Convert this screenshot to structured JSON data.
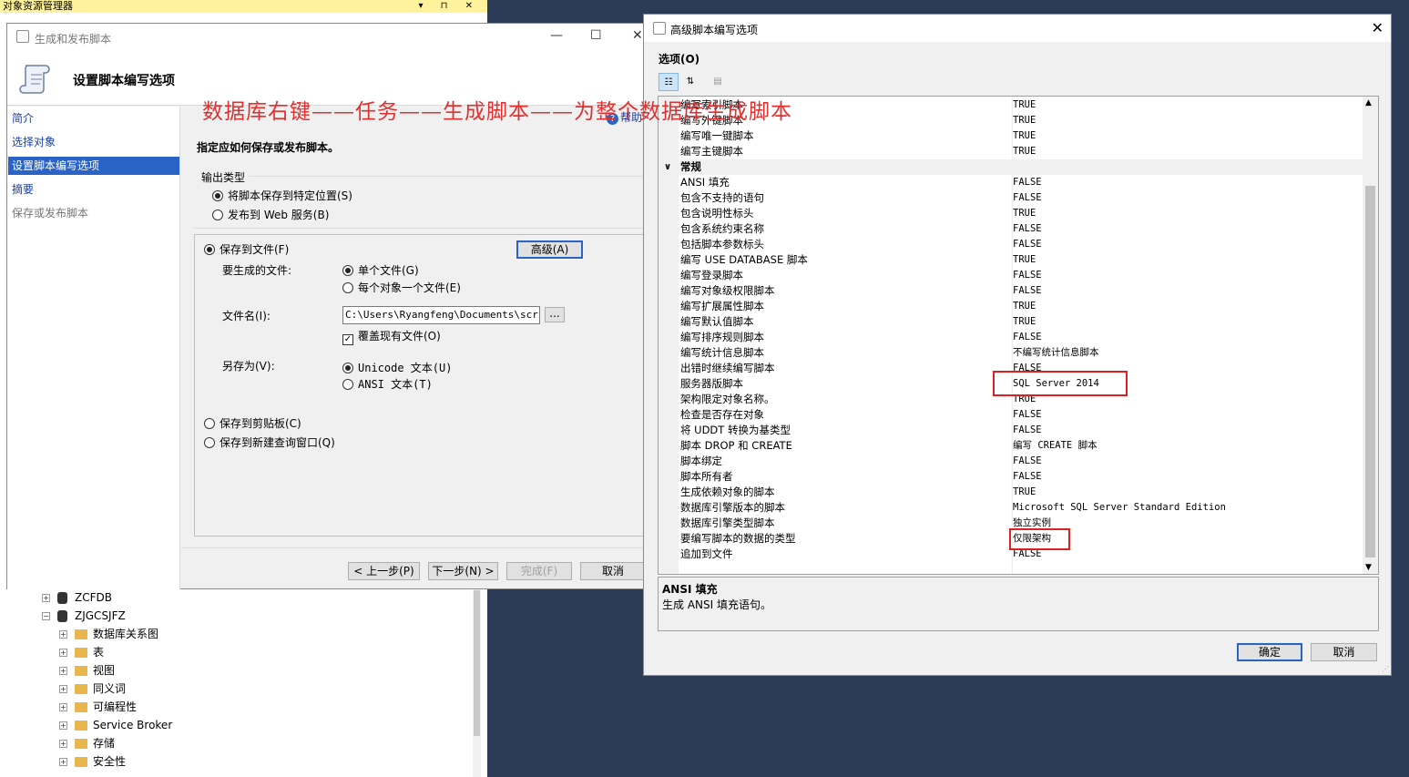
{
  "object_explorer": {
    "title": "对象资源管理器",
    "pin": "▾ ⊓ ✕",
    "tree": [
      {
        "expand": "+",
        "kind": "db",
        "label": "ZCFDB"
      },
      {
        "expand": "−",
        "kind": "db",
        "label": "ZJGCSJFZ"
      },
      {
        "expand": "+",
        "kind": "folder",
        "label": "数据库关系图"
      },
      {
        "expand": "+",
        "kind": "folder",
        "label": "表"
      },
      {
        "expand": "+",
        "kind": "folder",
        "label": "视图"
      },
      {
        "expand": "+",
        "kind": "folder",
        "label": "同义词"
      },
      {
        "expand": "+",
        "kind": "folder",
        "label": "可编程性"
      },
      {
        "expand": "+",
        "kind": "folder",
        "label": "Service Broker"
      },
      {
        "expand": "+",
        "kind": "folder",
        "label": "存储"
      },
      {
        "expand": "+",
        "kind": "folder",
        "label": "安全性"
      }
    ]
  },
  "wizard": {
    "window_title": "生成和发布脚本",
    "header_title": "设置脚本编写选项",
    "nav": [
      "简介",
      "选择对象",
      "设置脚本编写选项",
      "摘要",
      "保存或发布脚本"
    ],
    "help": "帮助",
    "instruction": "指定应如何保存或发布脚本。",
    "output_type_label": "输出类型",
    "output_save": "将脚本保存到特定位置(S)",
    "output_web": "发布到 Web 服务(B)",
    "save_to_file": "保存到文件(F)",
    "advanced_button": "高级(A)",
    "files_label": "要生成的文件:",
    "single_file": "单个文件(G)",
    "file_per_object": "每个对象一个文件(E)",
    "filename_label": "文件名(I):",
    "filename_value": "C:\\Users\\Ryangfeng\\Documents\\script",
    "browse": "...",
    "overwrite": "覆盖现有文件(O)",
    "save_as_label": "另存为(V):",
    "unicode": "Unicode 文本(U)",
    "ansi": "ANSI 文本(T)",
    "clipboard": "保存到剪贴板(C)",
    "new_query": "保存到新建查询窗口(Q)",
    "prev": "< 上一步(P)",
    "next": "下一步(N) >",
    "finish": "完成(F)",
    "cancel": "取消"
  },
  "annotation": "数据库右键——任务——生成脚本——为整个数据库生成脚本",
  "advanced": {
    "window_title": "高级脚本编写选项",
    "options_label": "选项(O)",
    "rows": [
      {
        "name": "编写索引脚本",
        "value": "TRUE"
      },
      {
        "name": "编写外键脚本",
        "value": "TRUE"
      },
      {
        "name": "编写唯一键脚本",
        "value": "TRUE"
      },
      {
        "name": "编写主键脚本",
        "value": "TRUE"
      },
      {
        "name": "常规",
        "category": true
      },
      {
        "name": "ANSI 填充",
        "value": "FALSE"
      },
      {
        "name": "包含不支持的语句",
        "value": "FALSE"
      },
      {
        "name": "包含说明性标头",
        "value": "TRUE"
      },
      {
        "name": "包含系统约束名称",
        "value": "FALSE"
      },
      {
        "name": "包括脚本参数标头",
        "value": "FALSE"
      },
      {
        "name": "编写 USE DATABASE 脚本",
        "value": "TRUE"
      },
      {
        "name": "编写登录脚本",
        "value": "FALSE"
      },
      {
        "name": "编写对象级权限脚本",
        "value": "FALSE"
      },
      {
        "name": "编写扩展属性脚本",
        "value": "TRUE"
      },
      {
        "name": "编写默认值脚本",
        "value": "TRUE"
      },
      {
        "name": "编写排序规则脚本",
        "value": "FALSE"
      },
      {
        "name": "编写统计信息脚本",
        "value": "不编写统计信息脚本"
      },
      {
        "name": "出错时继续编写脚本",
        "value": "FALSE"
      },
      {
        "name": "服务器版脚本",
        "value": "SQL Server 2014"
      },
      {
        "name": "架构限定对象名称。",
        "value": "TRUE"
      },
      {
        "name": "检查是否存在对象",
        "value": "FALSE"
      },
      {
        "name": "将 UDDT 转换为基类型",
        "value": "FALSE"
      },
      {
        "name": "脚本 DROP 和 CREATE",
        "value": "编写 CREATE 脚本"
      },
      {
        "name": "脚本绑定",
        "value": "FALSE"
      },
      {
        "name": "脚本所有者",
        "value": "FALSE"
      },
      {
        "name": "生成依赖对象的脚本",
        "value": "TRUE"
      },
      {
        "name": "数据库引擎版本的脚本",
        "value": "Microsoft SQL Server Standard Edition"
      },
      {
        "name": "数据库引擎类型脚本",
        "value": "独立实例"
      },
      {
        "name": "要编写脚本的数据的类型",
        "value": "仅限架构"
      },
      {
        "name": "追加到文件",
        "value": "FALSE"
      }
    ],
    "desc_title": "ANSI 填充",
    "desc_text": "生成 ANSI 填充语句。",
    "ok": "确定",
    "cancel": "取消"
  }
}
